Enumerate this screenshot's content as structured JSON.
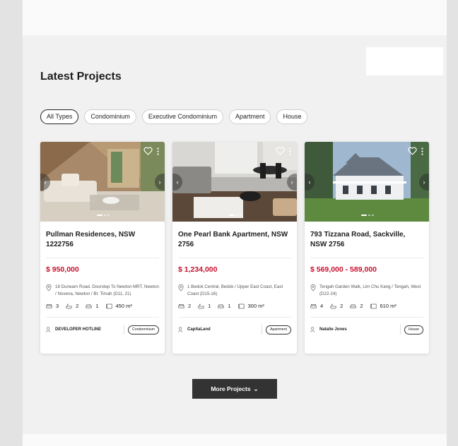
{
  "section": {
    "heading": "Latest Projects"
  },
  "filters": [
    "All Types",
    "Condominium",
    "Executive Condominium",
    "Apartment",
    "House"
  ],
  "active_filter": "All Types",
  "cards": [
    {
      "title": "Pullman Residences, NSW 1222756",
      "price": "$ 950,000",
      "address": "18 Dunearn Road. Doorstep To Newton MRT, Newton / Novena, Newton / Bt. Timah (D11, 21)",
      "beds": "3",
      "baths": "2",
      "parking": "1",
      "area": "450 m²",
      "agent": "DEVELOPER HOTLINE",
      "tag": "Condominium"
    },
    {
      "title": "One Pearl Bank Apartment, NSW 2756",
      "price": "$ 1,234,000",
      "address": "1 Bedok Central, Bedok / Upper East Coast, East Coast (D15-16)",
      "beds": "2",
      "baths": "1",
      "parking": "1",
      "area": "300 m²",
      "agent": "CapitaLand",
      "tag": "Apartment"
    },
    {
      "title": "793 Tizzana Road, Sackville, NSW 2756",
      "price": "$ 569,000 - 589,000",
      "address": "Tengah Garden Walk, Lim Chu Kang / Tengah, West (D22-24)",
      "beds": "4",
      "baths": "2",
      "parking": "2",
      "area": "610 m²",
      "agent": "Natalie Jones",
      "tag": "House"
    }
  ],
  "more_button": {
    "label": "More Projects"
  },
  "icons": [
    "heart-icon",
    "kebab-menu-icon",
    "chevron-left-icon",
    "chevron-right-icon",
    "location-pin-icon",
    "bed-icon",
    "bath-icon",
    "car-icon",
    "area-icon",
    "agent-icon",
    "chevron-down-icon"
  ],
  "colors": {
    "price": "#c8102e",
    "button": "#333333",
    "section_bg": "#f1f1f2"
  }
}
